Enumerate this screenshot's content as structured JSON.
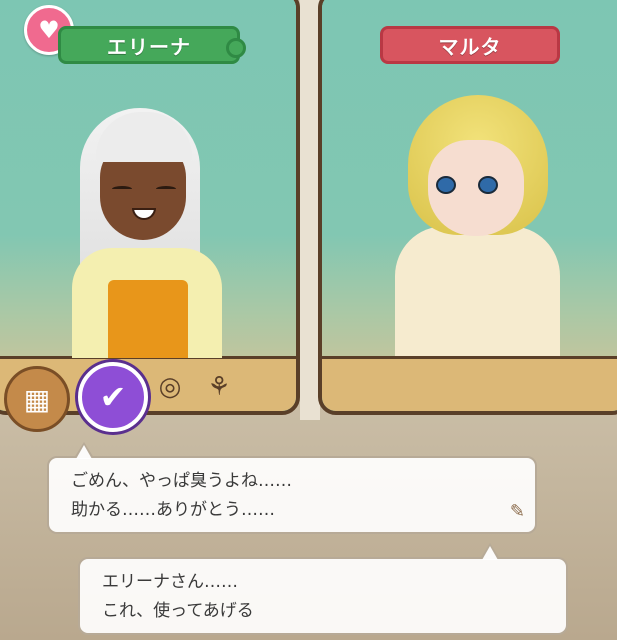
{
  "left_character": {
    "name": "エリーナ",
    "tag_color": "#45a85a",
    "badge_icon": "heart-icon"
  },
  "right_character": {
    "name": "マルタ",
    "tag_color": "#d8555f"
  },
  "footer_icons": [
    "building-icon",
    "check-icon",
    "ring-icon",
    "wheat-icon"
  ],
  "dialogue": {
    "top": {
      "line1": "ごめん、やっぱ臭うよね……",
      "line2": "助かる……ありがとう……",
      "indicator_icon": "quill-icon"
    },
    "bottom": {
      "line1": "エリーナさん……",
      "line2": "これ、使ってあげる"
    }
  }
}
